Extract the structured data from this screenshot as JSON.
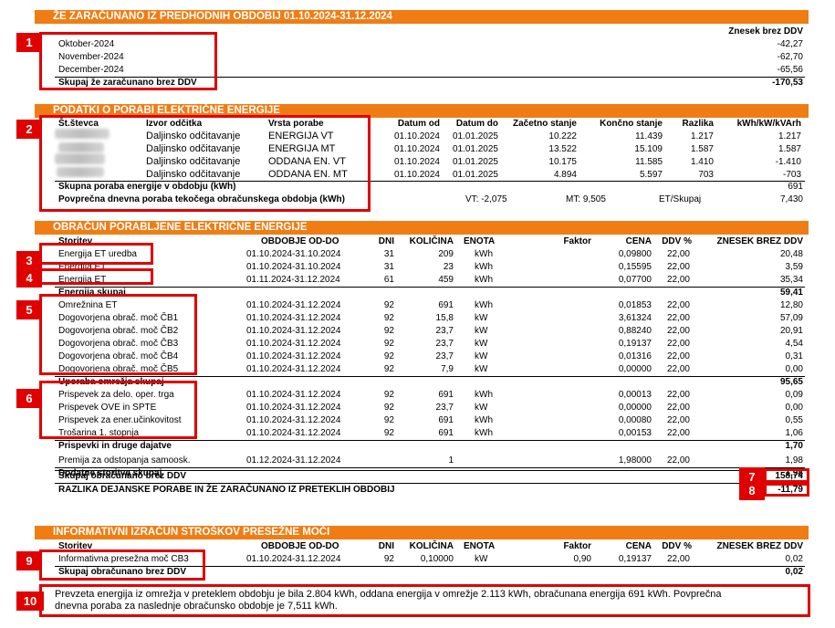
{
  "sec1": {
    "title": "ŽE ZARAČUNANO IZ PREDHODNIH OBDOBIJ 01.10.2024-31.12.2024",
    "col_header": "Znesek brez DDV",
    "rows": [
      {
        "label": "Oktober-2024",
        "value": "-42,27"
      },
      {
        "label": "November-2024",
        "value": "-62,70"
      },
      {
        "label": "December-2024",
        "value": "-65,56"
      }
    ],
    "total_label": "Skupaj že zaračunano brez DDV",
    "total_value": "-170,53"
  },
  "sec2": {
    "title": "PODATKI O PORABI ELEKTRIČNE ENERGIJE",
    "headers": [
      "Št.števca",
      "Izvor odčitka",
      "Vrsta porabe",
      "Datum od",
      "Datum do",
      "Začetno stanje",
      "Končno stanje",
      "Razlika",
      "kWh/kW/kVArh"
    ],
    "rows": [
      [
        "Daljinsko odčitavanje",
        "ENERGIJA VT",
        "01.10.2024",
        "01.01.2025",
        "10.222",
        "11.439",
        "1.217",
        "1.217"
      ],
      [
        "Daljinsko odčitavanje",
        "ENERGIJA MT",
        "01.10.2024",
        "01.01.2025",
        "13.522",
        "15.109",
        "1.587",
        "1.587"
      ],
      [
        "Daljinsko odčitavanje",
        "ODDANA EN. VT",
        "01.10.2024",
        "01.01.2025",
        "10.175",
        "11.585",
        "1.410",
        "-1.410"
      ],
      [
        "Daljinsko odčitavanje",
        "ODDANA EN. MT",
        "01.10.2024",
        "01.01.2025",
        "4.894",
        "5.597",
        "703",
        "-703"
      ]
    ],
    "total_label": "Skupna poraba energije v obdobju (kWh)",
    "total_value": "691",
    "avg_label": "Povprečna dnevna poraba tekočega obračunskega obdobja (kWh)",
    "avg_vt": "VT: -2,075",
    "avg_mt": "MT: 9,505",
    "avg_et_label": "ET/Skupaj",
    "avg_et": "7,430"
  },
  "sec3": {
    "title": "OBRAČUN PORABLJENE ELEKTRIČNE ENERGIJE",
    "headers": [
      "Storitev",
      "OBDOBJE OD-DO",
      "DNI",
      "KOLIČINA",
      "ENOTA",
      "Faktor",
      "CENA",
      "DDV %",
      "ZNESEK BREZ DDV"
    ],
    "rows": [
      {
        "s": "Energija ET uredba",
        "p": "01.10.2024-31.10.2024",
        "d": "31",
        "q": "209",
        "u": "kWh",
        "f": "",
        "c": "0,09800",
        "v": "22,00",
        "z": "20,48"
      },
      {
        "s": "Energija ET",
        "p": "01.10.2024-31.10.2024",
        "d": "31",
        "q": "23",
        "u": "kWh",
        "f": "",
        "c": "0,15595",
        "v": "22,00",
        "z": "3,59"
      },
      {
        "s": "Energija ET",
        "p": "01.11.2024-31.12.2024",
        "d": "61",
        "q": "459",
        "u": "kWh",
        "f": "",
        "c": "0,07700",
        "v": "22,00",
        "z": "35,34"
      },
      {
        "s": "Energija skupaj",
        "bold": true,
        "z": "59,41"
      },
      {
        "s": "Omrežnina ET",
        "p": "01.10.2024-31.12.2024",
        "d": "92",
        "q": "691",
        "u": "kWh",
        "f": "",
        "c": "0,01853",
        "v": "22,00",
        "z": "12,80"
      },
      {
        "s": "Dogovorjena obrač. moč ČB1",
        "p": "01.10.2024-31.12.2024",
        "d": "92",
        "q": "15,8",
        "u": "kW",
        "f": "",
        "c": "3,61324",
        "v": "22,00",
        "z": "57,09"
      },
      {
        "s": "Dogovorjena obrač. moč ČB2",
        "p": "01.10.2024-31.12.2024",
        "d": "92",
        "q": "23,7",
        "u": "kW",
        "f": "",
        "c": "0,88240",
        "v": "22,00",
        "z": "20,91"
      },
      {
        "s": "Dogovorjena obrač. moč ČB3",
        "p": "01.10.2024-31.12.2024",
        "d": "92",
        "q": "23,7",
        "u": "kW",
        "f": "",
        "c": "0,19137",
        "v": "22,00",
        "z": "4,54"
      },
      {
        "s": "Dogovorjena obrač. moč ČB4",
        "p": "01.10.2024-31.12.2024",
        "d": "92",
        "q": "23,7",
        "u": "kW",
        "f": "",
        "c": "0,01316",
        "v": "22,00",
        "z": "0,31"
      },
      {
        "s": "Dogovorjena obrač. moč ČB5",
        "p": "01.10.2024-31.12.2024",
        "d": "92",
        "q": "7,9",
        "u": "kW",
        "f": "",
        "c": "0,00000",
        "v": "22,00",
        "z": "0,00"
      },
      {
        "s": "Uporaba omrežja skupaj",
        "bold": true,
        "z": "95,65"
      },
      {
        "s": "Prispevek za delo. oper. trga",
        "p": "01.10.2024-31.12.2024",
        "d": "92",
        "q": "691",
        "u": "kWh",
        "f": "",
        "c": "0,00013",
        "v": "22,00",
        "z": "0,09"
      },
      {
        "s": "Prispevek OVE in SPTE",
        "p": "01.10.2024-31.12.2024",
        "d": "92",
        "q": "23,7",
        "u": "kW",
        "f": "",
        "c": "0,00000",
        "v": "22,00",
        "z": "0,00"
      },
      {
        "s": "Prispevek za ener.učinkovitost",
        "p": "01.10.2024-31.12.2024",
        "d": "92",
        "q": "691",
        "u": "kWh",
        "f": "",
        "c": "0,00080",
        "v": "22,00",
        "z": "0,55"
      },
      {
        "s": "Trošarina 1. stopnja",
        "p": "01.10.2024-31.12.2024",
        "d": "92",
        "q": "691",
        "u": "kWh",
        "f": "",
        "c": "0,00153",
        "v": "22,00",
        "z": "1,06"
      },
      {
        "s": "Prispevki in druge dajatve",
        "bold": true,
        "z": "1,70"
      },
      {
        "s": "Premija za odstopanja samoosk.",
        "p": "01.12.2024-31.12.2024",
        "d": "",
        "q": "1",
        "u": "",
        "f": "",
        "c": "1,98000",
        "v": "22,00",
        "z": "1,98"
      },
      {
        "s": "Dodatne storitve skupaj",
        "bold": true,
        "z": "1,98"
      }
    ],
    "total_label": "Skupaj obračunano brez DDV",
    "total_value": "158,74",
    "diff_label": "RAZLIKA DEJANSKE PORABE IN ŽE ZARAČUNANO IZ PRETEKLIH OBDOBIJ",
    "diff_value": "-11,79"
  },
  "sec4": {
    "title": "INFORMATIVNI IZRAČUN STROŠKOV PRESEŽNE MOČI",
    "headers": [
      "Storitev",
      "OBDOBJE OD-DO",
      "DNI",
      "KOLIČINA",
      "ENOTA",
      "Faktor",
      "CENA",
      "DDV %",
      "ZNESEK BREZ DDV"
    ],
    "row": {
      "s": "Informativna presežna moč CB3",
      "p": "01.10.2024-31.12.2024",
      "d": "92",
      "q": "0,10000",
      "u": "kW",
      "f": "0,90",
      "c": "0,19137",
      "v": "22,00",
      "z": "0,02"
    },
    "total_label": "Skupaj obračunano brez DDV",
    "total_value": "0,02"
  },
  "note": {
    "line1": "Prevzeta energija iz omrežja v preteklem obdobju je bila 2.804 kWh, oddana energija v omrežje 2.113 kWh, obračunana energija 691 kWh. Povprečna",
    "line2": "dnevna poraba za naslednje obračunsko obdobje je 7,511 kWh."
  },
  "tags": [
    "1",
    "2",
    "3",
    "4",
    "5",
    "6",
    "7",
    "8",
    "9",
    "10"
  ]
}
